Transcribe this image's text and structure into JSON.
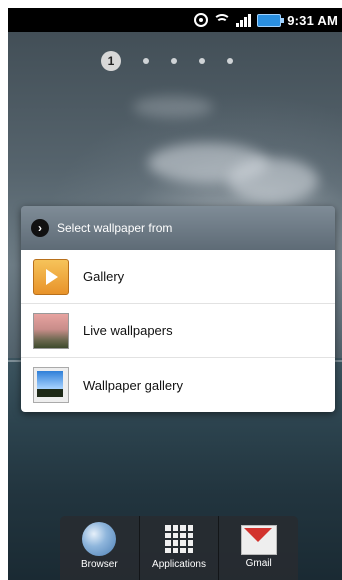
{
  "statusbar": {
    "time": "9:31 AM",
    "icons": [
      "gps-icon",
      "wifi-icon",
      "signal-icon",
      "battery-icon"
    ]
  },
  "home": {
    "current_page": "1",
    "page_count": 5
  },
  "dialog": {
    "title": "Select wallpaper from",
    "items": [
      {
        "label": "Gallery",
        "icon": "gallery-icon"
      },
      {
        "label": "Live wallpapers",
        "icon": "live-wallpapers-icon"
      },
      {
        "label": "Wallpaper gallery",
        "icon": "wallpaper-gallery-icon"
      }
    ]
  },
  "dock": {
    "items": [
      {
        "label": "Browser",
        "icon": "browser-icon"
      },
      {
        "label": "Applications",
        "icon": "applications-icon"
      },
      {
        "label": "Gmail",
        "icon": "gmail-icon"
      }
    ]
  },
  "colors": {
    "battery": "#2a8fe0",
    "dialog_header": "#6f7c87",
    "gmail_red": "#d2322d"
  }
}
